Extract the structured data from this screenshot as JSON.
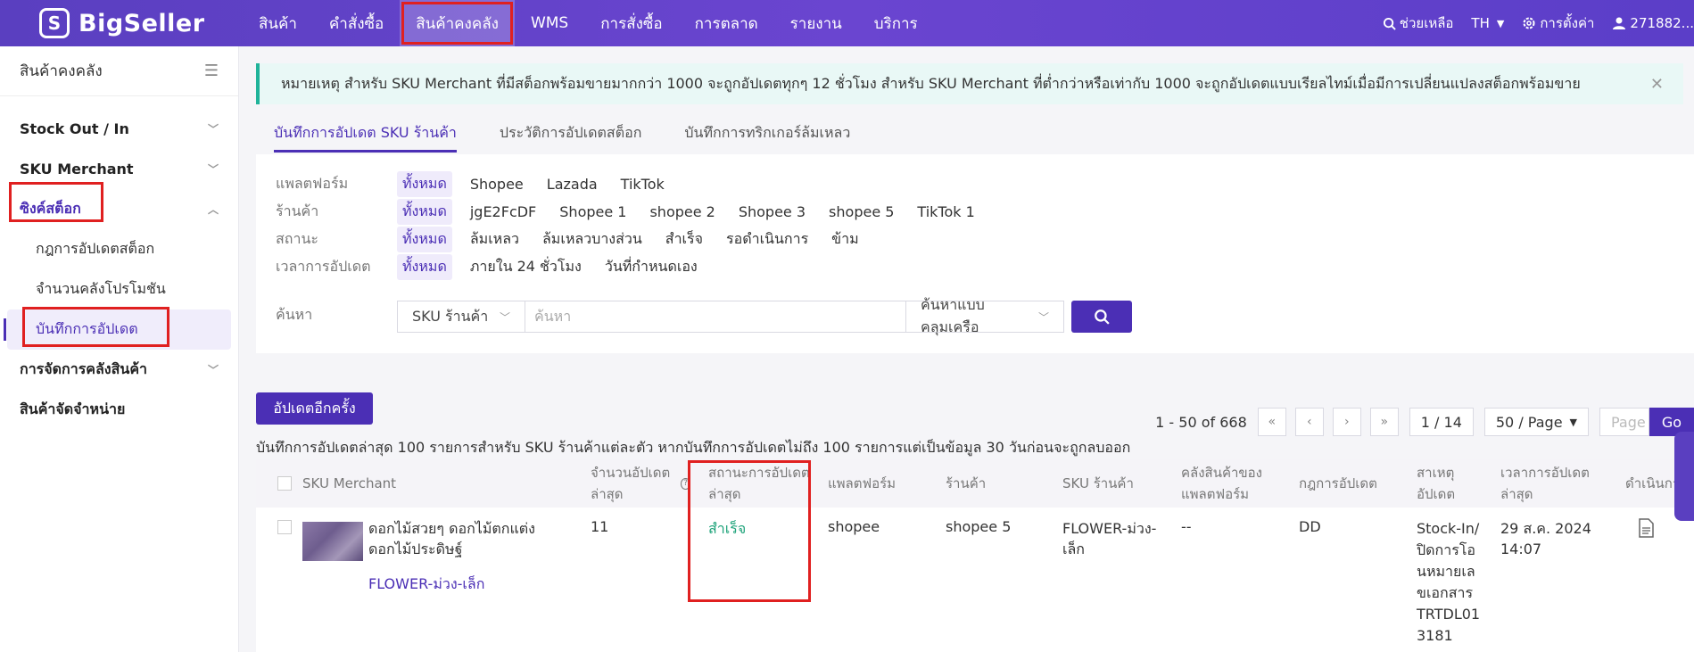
{
  "brand": {
    "name": "BigSeller",
    "mark": "S"
  },
  "nav": [
    "สินค้า",
    "คำสั่งซื้อ",
    "สินค้าคงคลัง",
    "WMS",
    "การสั่งซื้อ",
    "การตลาด",
    "รายงาน",
    "บริการ"
  ],
  "tools": {
    "help": "ช่วยเหลือ",
    "lang": "TH",
    "settings": "การตั้งค่า",
    "user": "271882..."
  },
  "sidebar": {
    "title": "สินค้าคงคลัง",
    "groups": [
      {
        "label": "Stock Out / In"
      },
      {
        "label": "SKU Merchant"
      },
      {
        "label": "ซิงค์สต็อก",
        "subs": [
          "กฎการอัปเดตสต็อก",
          "จำนวนคลังโปรโมชัน",
          "บันทึกการอัปเดต"
        ]
      },
      {
        "label": "การจัดการคลังสินค้า"
      },
      {
        "label": "สินค้าจัดจำหน่าย"
      }
    ]
  },
  "notice": "หมายเหตุ สำหรับ SKU Merchant ที่มีสต็อกพร้อมขายมากกว่า 1000 จะถูกอัปเดตทุกๆ 12 ชั่วโมง สำหรับ SKU Merchant ที่ต่ำกว่าหรือเท่ากับ 1000 จะถูกอัปเดตแบบเรียลไทม์เมื่อมีการเปลี่ยนแปลงสต็อกพร้อมขาย",
  "tabs": [
    "บันทึกการอัปเดต SKU ร้านค้า",
    "ประวัติการอัปเดตสต็อก",
    "บันทึกการทริกเกอร์ล้มเหลว"
  ],
  "filters": {
    "platform": {
      "label": "แพลตฟอร์ม",
      "options": [
        "ทั้งหมด",
        "Shopee",
        "Lazada",
        "TikTok"
      ]
    },
    "store": {
      "label": "ร้านค้า",
      "options": [
        "ทั้งหมด",
        "jgE2FcDF",
        "Shopee 1",
        "shopee 2",
        "Shopee 3",
        "shopee 5",
        "TikTok 1"
      ]
    },
    "status": {
      "label": "สถานะ",
      "options": [
        "ทั้งหมด",
        "ล้มเหลว",
        "ล้มเหลวบางส่วน",
        "สำเร็จ",
        "รอดำเนินการ",
        "ข้าม"
      ]
    },
    "time": {
      "label": "เวลาการอัปเดต",
      "options": [
        "ทั้งหมด",
        "ภายใน 24 ชั่วโมง",
        "วันที่กำหนดเอง"
      ]
    },
    "search": {
      "label": "ค้นหา",
      "field": "SKU ร้านค้า",
      "placeholder": "ค้นหา",
      "mode": "ค้นหาแบบคลุมเครือ"
    }
  },
  "actions": {
    "update_again": "อัปเดตอีกครั้ง"
  },
  "pager": {
    "range": "1 - 50 of 668",
    "page": "1 / 14",
    "per_page": "50 / Page",
    "page_placeholder": "Page",
    "go": "Go"
  },
  "hint": "บันทึกการอัปเดตล่าสุด 100 รายการสำหรับ SKU ร้านค้าแต่ละตัว หากบันทึกการอัปเดตไม่ถึง 100 รายการแต่เป็นข้อมูล 30 วันก่อนจะถูกลบออก",
  "table": {
    "headers": [
      "SKU Merchant",
      "จำนวนอัปเดตล่าสุด",
      "สถานะการอัปเดตล่าสุด",
      "แพลตฟอร์ม",
      "ร้านค้า",
      "SKU ร้านค้า",
      "คลังสินค้าของแพลตฟอร์ม",
      "กฎการอัปเดต",
      "สาเหตุอัปเดต",
      "เวลาการอัปเดตล่าสุด",
      "ดำเนินการ"
    ],
    "rows": [
      {
        "name": "ดอกไม้สวยๆ ดอกไม้ตกแต่ง ดอกไม้ประดิษฐ์",
        "sku": "FLOWER-ม่วง-เล็ก",
        "qty": "11",
        "status": "สำเร็จ",
        "platform": "shopee",
        "store": "shopee 5",
        "store_sku": "FLOWER-ม่วง-เล็ก",
        "warehouse": "--",
        "rule": "DD",
        "reason": "Stock-In/ปิดการโอนหมายเลขเอกสาร TRTDL013181",
        "time": "29 ส.ค. 2024 14:07"
      }
    ]
  },
  "colors": {
    "primary": "#4b2fb5",
    "success": "#1ea37a",
    "highlight": "#e02020"
  }
}
